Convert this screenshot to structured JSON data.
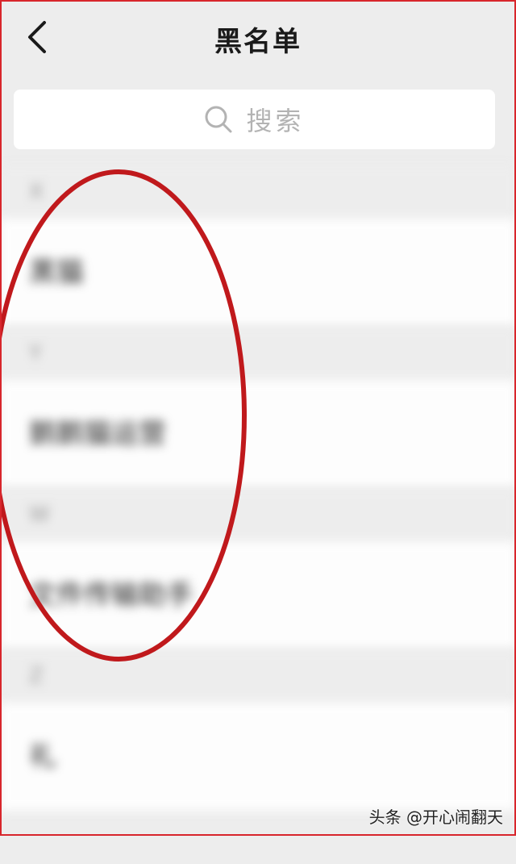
{
  "header": {
    "title": "黑名单",
    "back_icon": "chevron-left-icon"
  },
  "search": {
    "placeholder": "搜索",
    "icon": "search-icon"
  },
  "list": {
    "sections": [
      {
        "letter": "X",
        "items": [
          {
            "name": "黑猫"
          }
        ]
      },
      {
        "letter": "Y",
        "items": [
          {
            "name": "鹅鹅猫运营"
          }
        ]
      },
      {
        "letter": "W",
        "items": [
          {
            "name": "文件传输助手"
          }
        ]
      },
      {
        "letter": "Z",
        "items": [
          {
            "name": "礼"
          }
        ]
      }
    ]
  },
  "colors": {
    "annotation": "#c0191c",
    "frame": "#d8262c"
  },
  "watermark": "头条 @开心闹翻天"
}
